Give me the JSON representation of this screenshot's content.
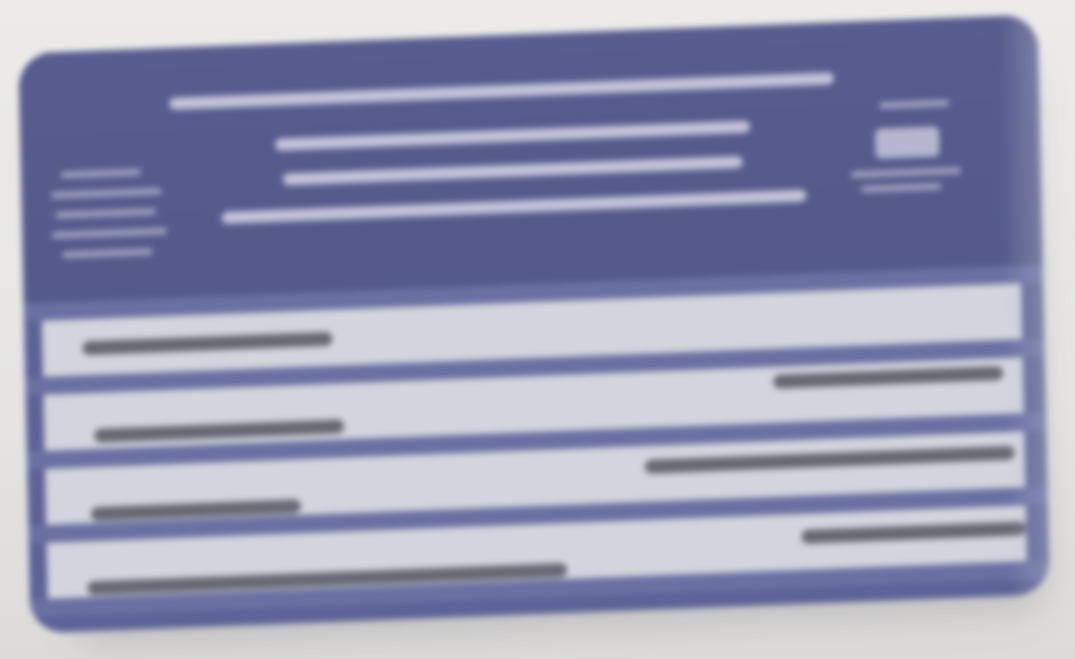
{
  "scene": {
    "background_color": "#e9e8e6",
    "object": "card",
    "card_color": "#5d6396",
    "row_color": "#d3d4dc",
    "text_legible": false
  }
}
